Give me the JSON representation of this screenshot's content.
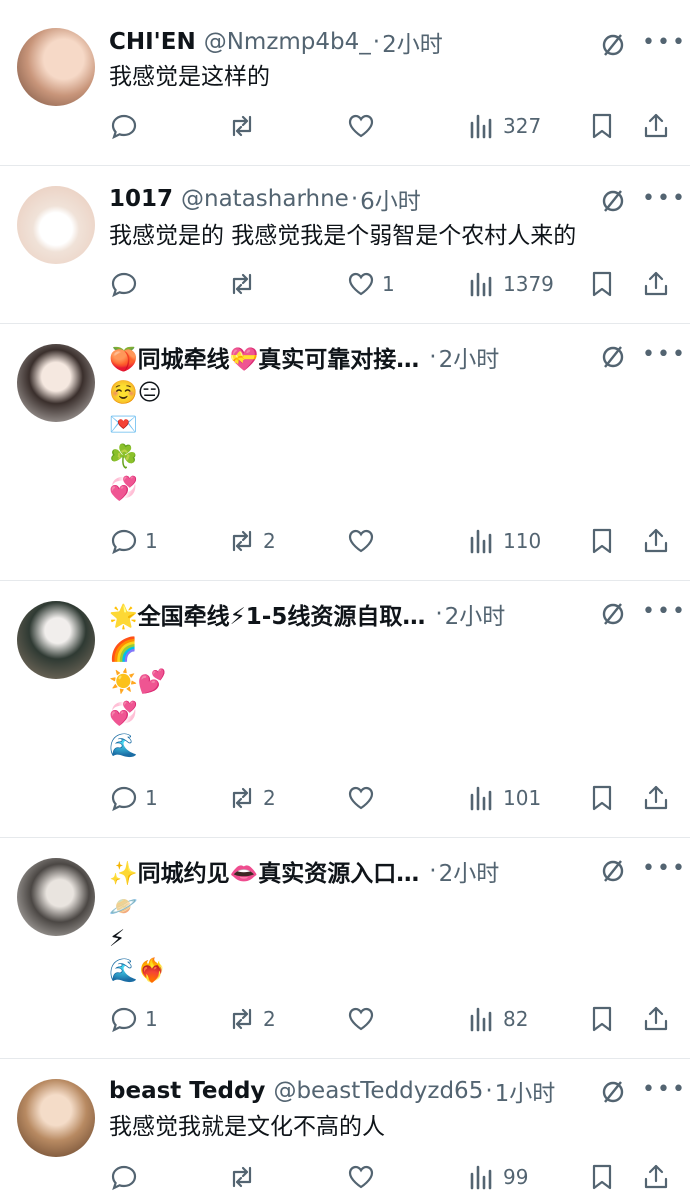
{
  "tweets": [
    {
      "name": "CHI'EN",
      "handle": "@Nmzmp4b4_",
      "separator": "·",
      "time": "2小时",
      "lines": [
        "我感觉是这样的"
      ],
      "reply_count": "",
      "retweet_count": "",
      "like_count": "",
      "view_count": "327"
    },
    {
      "name": "1017",
      "handle": "@natasharhne",
      "separator": "·",
      "time": "6小时",
      "lines": [
        "我感觉是的 我感觉我是个弱智是个农村人来的"
      ],
      "reply_count": "",
      "retweet_count": "",
      "like_count": "1",
      "view_count": "1379"
    },
    {
      "name": "🍑同城牵线💝真实可靠对接…",
      "handle": "",
      "separator": "·",
      "time": "2小时",
      "lines": [
        "☺️😑",
        "💌",
        "☘️",
        "💞"
      ],
      "reply_count": "1",
      "retweet_count": "2",
      "like_count": "",
      "view_count": "110"
    },
    {
      "name": "🌟全国牵线⚡1-5线资源自取…",
      "handle": "",
      "separator": "·",
      "time": "2小时",
      "lines": [
        "🌈",
        "☀️💕",
        "💞",
        "🌊"
      ],
      "reply_count": "1",
      "retweet_count": "2",
      "like_count": "",
      "view_count": "101"
    },
    {
      "name": "✨同城约见👄真实资源入口…",
      "handle": "",
      "separator": "·",
      "time": "2小时",
      "lines": [
        "🪐",
        "⚡",
        "🌊❤️‍🔥"
      ],
      "reply_count": "1",
      "retweet_count": "2",
      "like_count": "",
      "view_count": "82"
    },
    {
      "name": "beast Teddy",
      "handle": "@beastTeddyzd65",
      "separator": "·",
      "time": "1小时",
      "lines": [
        "我感觉我就是文化不高的人"
      ],
      "reply_count": "",
      "retweet_count": "",
      "like_count": "",
      "view_count": "99"
    }
  ],
  "icons": {
    "reply": "reply-icon",
    "retweet": "retweet-icon",
    "like": "like-icon",
    "views": "views-icon",
    "bookmark": "bookmark-icon",
    "share": "share-icon",
    "grok": "grok-icon",
    "more": "more-icon"
  },
  "colors": {
    "secondary_text": "#536471",
    "divider": "#e6e9ec",
    "primary_text": "#0f1419"
  }
}
